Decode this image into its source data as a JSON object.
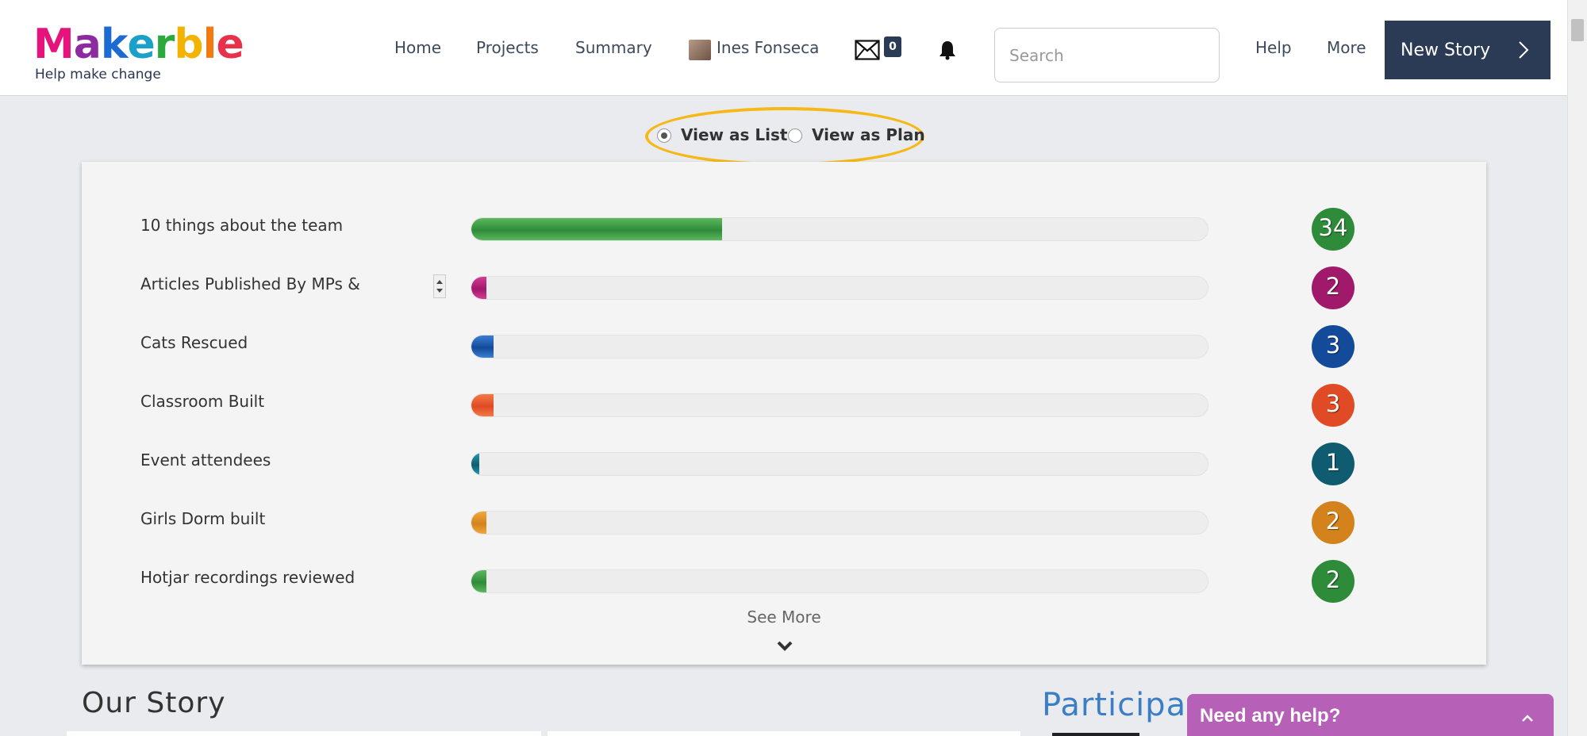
{
  "logo": {
    "letters": [
      {
        "ch": "M",
        "color": "#e6137c"
      },
      {
        "ch": "a",
        "color": "#8c2b9f"
      },
      {
        "ch": "k",
        "color": "#1c6bd2"
      },
      {
        "ch": "e",
        "color": "#1aa0c9"
      },
      {
        "ch": "r",
        "color": "#2aaa3c"
      },
      {
        "ch": "b",
        "color": "#f2b400"
      },
      {
        "ch": "l",
        "color": "#f27a12"
      },
      {
        "ch": "e",
        "color": "#e8314a"
      }
    ],
    "tagline": "Help make change"
  },
  "nav": {
    "home": "Home",
    "projects": "Projects",
    "summary": "Summary",
    "user": "Ines Fonseca",
    "mail_count": "0",
    "search_placeholder": "Search",
    "help": "Help",
    "more": "More",
    "new_story": "New Story"
  },
  "view_toggle": {
    "list_label": "View as List",
    "plan_label": "View as Plan",
    "selected": "list"
  },
  "outcomes": [
    {
      "label": "10 things about the team",
      "count": "34",
      "progress": 0.34,
      "color": "#2e8b3a",
      "color_light": "#5cb85c"
    },
    {
      "label": "Articles Published By MPs &",
      "count": "2",
      "progress": 0.02,
      "color": "#a0196a",
      "color_light": "#d63a93"
    },
    {
      "label": "Cats Rescued",
      "count": "3",
      "progress": 0.03,
      "color": "#134a9a",
      "color_light": "#3a7fd4"
    },
    {
      "label": "Classroom Built",
      "count": "3",
      "progress": 0.03,
      "color": "#e04a25",
      "color_light": "#f27a45"
    },
    {
      "label": "Event attendees",
      "count": "1",
      "progress": 0.01,
      "color": "#0f5b70",
      "color_light": "#2a9bb0"
    },
    {
      "label": "Girls Dorm built",
      "count": "2",
      "progress": 0.02,
      "color": "#d4821c",
      "color_light": "#f0a83a"
    },
    {
      "label": "Hotjar recordings reviewed",
      "count": "2",
      "progress": 0.02,
      "color": "#2e8b3a",
      "color_light": "#5cb85c"
    }
  ],
  "see_more": "See More",
  "sections": {
    "our_story": "Our Story",
    "participants": "Participa"
  },
  "help_widget": {
    "label": "Need any help?"
  }
}
